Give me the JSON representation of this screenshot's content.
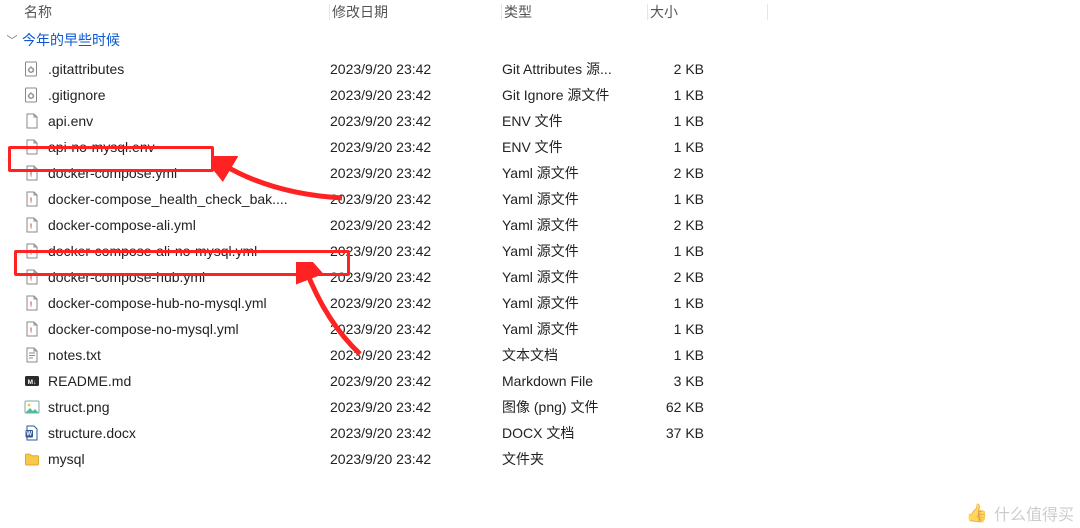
{
  "columns": {
    "name": "名称",
    "date": "修改日期",
    "type": "类型",
    "size": "大小"
  },
  "group": {
    "label": "今年的早些时候"
  },
  "files": [
    {
      "icon": "gear",
      "name": ".gitattributes",
      "date": "2023/9/20 23:42",
      "type": "Git Attributes 源...",
      "size": "2 KB"
    },
    {
      "icon": "gear",
      "name": ".gitignore",
      "date": "2023/9/20 23:42",
      "type": "Git Ignore 源文件",
      "size": "1 KB"
    },
    {
      "icon": "page",
      "name": "api.env",
      "date": "2023/9/20 23:42",
      "type": "ENV 文件",
      "size": "1 KB"
    },
    {
      "icon": "page",
      "name": "api-no-mysql.env",
      "date": "2023/9/20 23:42",
      "type": "ENV 文件",
      "size": "1 KB"
    },
    {
      "icon": "yaml",
      "name": "docker-compose.yml",
      "date": "2023/9/20 23:42",
      "type": "Yaml 源文件",
      "size": "2 KB"
    },
    {
      "icon": "yaml",
      "name": "docker-compose_health_check_bak....",
      "date": "2023/9/20 23:42",
      "type": "Yaml 源文件",
      "size": "1 KB"
    },
    {
      "icon": "yaml",
      "name": "docker-compose-ali.yml",
      "date": "2023/9/20 23:42",
      "type": "Yaml 源文件",
      "size": "2 KB"
    },
    {
      "icon": "yaml",
      "name": "docker-compose-ali-no-mysql.yml",
      "date": "2023/9/20 23:42",
      "type": "Yaml 源文件",
      "size": "1 KB"
    },
    {
      "icon": "yaml",
      "name": "docker-compose-hub.yml",
      "date": "2023/9/20 23:42",
      "type": "Yaml 源文件",
      "size": "2 KB"
    },
    {
      "icon": "yaml",
      "name": "docker-compose-hub-no-mysql.yml",
      "date": "2023/9/20 23:42",
      "type": "Yaml 源文件",
      "size": "1 KB"
    },
    {
      "icon": "yaml",
      "name": "docker-compose-no-mysql.yml",
      "date": "2023/9/20 23:42",
      "type": "Yaml 源文件",
      "size": "1 KB"
    },
    {
      "icon": "text",
      "name": "notes.txt",
      "date": "2023/9/20 23:42",
      "type": "文本文档",
      "size": "1 KB"
    },
    {
      "icon": "md",
      "name": "README.md",
      "date": "2023/9/20 23:42",
      "type": "Markdown File",
      "size": "3 KB"
    },
    {
      "icon": "png",
      "name": "struct.png",
      "date": "2023/9/20 23:42",
      "type": "图像 (png) 文件",
      "size": "62 KB"
    },
    {
      "icon": "docx",
      "name": "structure.docx",
      "date": "2023/9/20 23:42",
      "type": "DOCX 文档",
      "size": "37 KB"
    },
    {
      "icon": "folder",
      "name": "mysql",
      "date": "2023/9/20 23:42",
      "type": "文件夹",
      "size": ""
    }
  ],
  "watermark": {
    "text": "什么值得买"
  },
  "annotations": {
    "highlight_rows": [
      3,
      7
    ],
    "highlight_color": "#ff2222"
  }
}
